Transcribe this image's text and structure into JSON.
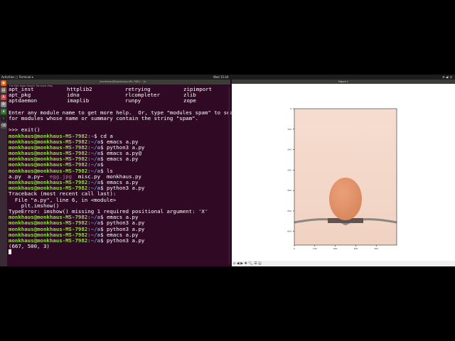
{
  "topbar": {
    "left": "Activities   ▢ Terminal ▾",
    "center": "Wed 15:44",
    "right": "⚙ ◀) ⏻"
  },
  "terminal": {
    "title": "monkhaus@monkhaus-MS-7982: ~/a",
    "menu": "File  Edit  View  Search  Terminal  Help",
    "modules": [
      [
        "apt_inst",
        "httplib2",
        "retrying",
        "zipimport"
      ],
      [
        "apt_pkg",
        "idna",
        "rlcompleter",
        "zlib"
      ],
      [
        "aptdaemon",
        "imaplib",
        "runpy",
        "zope"
      ]
    ],
    "prompt_user": "monkhaus@monkhaus-MS-7982",
    "lines_pre": [
      "",
      "Enter any module name to get more help.  Or, type \"modules spam\" to search",
      "for modules whose name or summary contain the string \"spam\".",
      "",
      ">>> exit()"
    ],
    "commands": [
      {
        "path": ":~",
        "cmd": "$ cd a"
      },
      {
        "path": ":~/a",
        "cmd": "$ emacs a.py"
      },
      {
        "path": ":~/a",
        "cmd": "$ python3 a.py"
      },
      {
        "path": ":~/a",
        "cmd": "$ emacs a.py@"
      },
      {
        "path": ":~/a",
        "cmd": "$ emacs a.py"
      },
      {
        "path": ":~/a",
        "cmd": "$"
      },
      {
        "path": ":~/a",
        "cmd": "$ ls"
      }
    ],
    "ls_output": {
      "a": "a.py  a.py~  ",
      "img": "egg.jpg",
      "b": "  misc.py  monkhaus.py"
    },
    "commands2": [
      {
        "path": ":~/a",
        "cmd": "$ emacs a.py"
      },
      {
        "path": ":~/a",
        "cmd": "$ python3 a.py"
      }
    ],
    "traceback": [
      "Traceback (most recent call last):",
      "  File \"a.py\", line 6, in <module>",
      "    plt.imshow()",
      "TypeError: imshow() missing 1 required positional argument: 'X'"
    ],
    "commands3": [
      {
        "path": ":~/a",
        "cmd": "$ emacs a.py"
      },
      {
        "path": ":~/a",
        "cmd": "$ python3 a.py"
      },
      {
        "path": ":~/a",
        "cmd": "$ python3 a.py"
      },
      {
        "path": ":~/a",
        "cmd": "$ emacs a.py"
      },
      {
        "path": ":~/a",
        "cmd": "$ python3 a.py"
      }
    ],
    "output": "(667, 500, 3)"
  },
  "figure": {
    "title": "Figure 1",
    "xticks": [
      "0",
      "100",
      "200",
      "300",
      "400"
    ],
    "yticks": [
      "0",
      "100",
      "200",
      "300",
      "400",
      "500",
      "600"
    ],
    "toolbar": "⌂ ◀ ▶ ✥ 🔍 ☰ 🖫",
    "colors": {
      "bg_top": "#f6ddd0",
      "bg_bottom": "#f0d2c2",
      "egg": "#d9865a",
      "fork": "#8a8683"
    }
  },
  "launcher_icons": [
    "firefox-icon",
    "files-icon",
    "software-icon",
    "settings-icon",
    "amazon-icon",
    "terminal-icon",
    "trash-icon"
  ]
}
